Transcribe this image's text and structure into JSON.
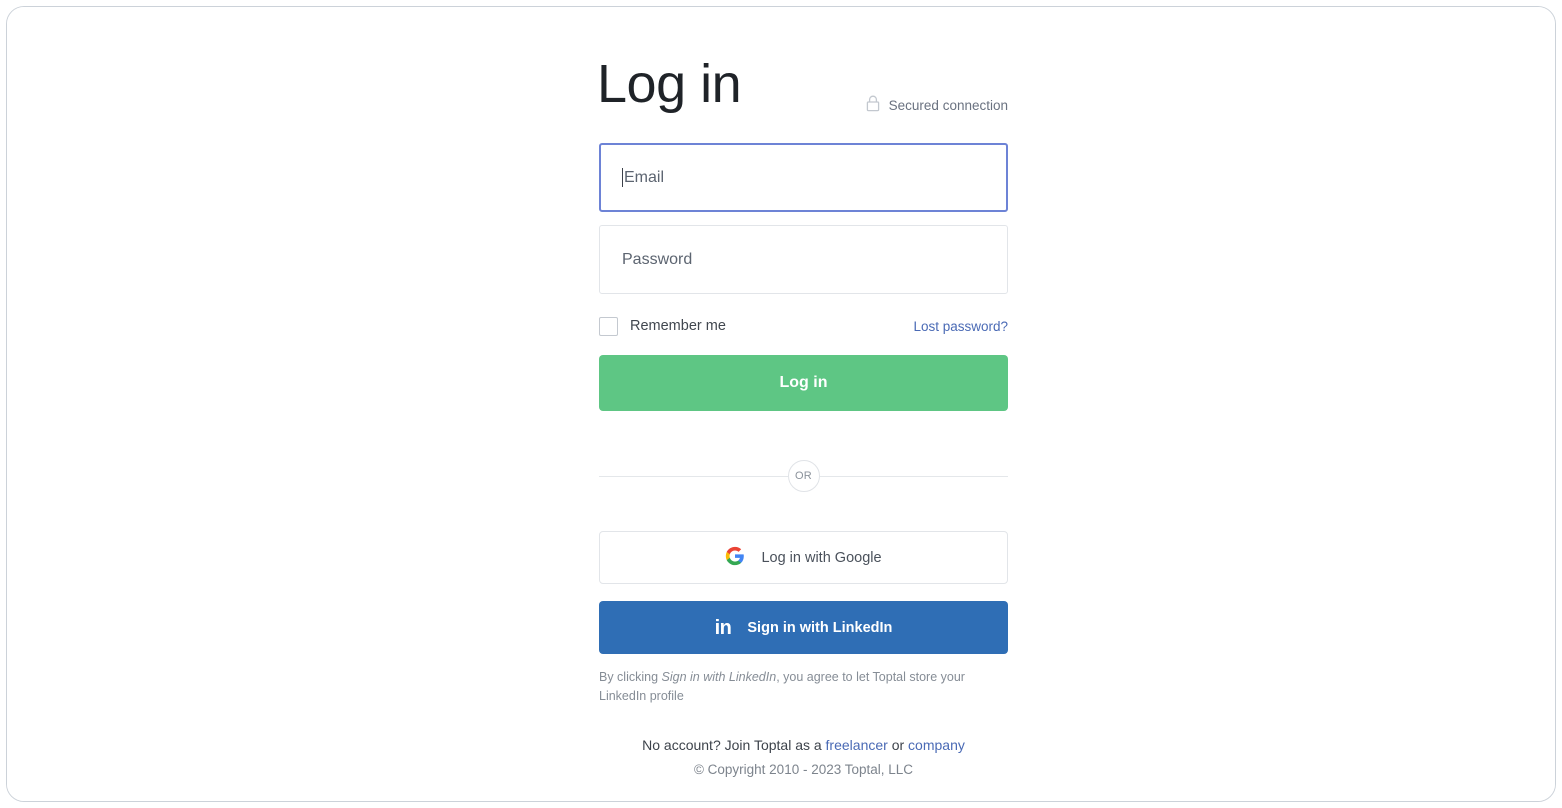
{
  "header": {
    "title": "Log in",
    "secured_text": "Secured connection",
    "lock_icon": "lock-icon"
  },
  "form": {
    "email": {
      "placeholder": "Email",
      "value": "",
      "focused": true
    },
    "password": {
      "placeholder": "Password",
      "value": ""
    },
    "remember_label": "Remember me",
    "remember_checked": false,
    "lost_password_label": "Lost password?",
    "submit_label": "Log in"
  },
  "divider": {
    "label": "OR"
  },
  "social": {
    "google": {
      "label": "Log in with Google",
      "icon": "google-g-icon"
    },
    "linkedin": {
      "label": "Sign in with LinkedIn",
      "icon": "linkedin-in-icon"
    },
    "disclaimer_prefix": "By clicking ",
    "disclaimer_emphasis": "Sign in with LinkedIn",
    "disclaimer_suffix": ", you agree to let Toptal store your LinkedIn profile"
  },
  "footer": {
    "join_prefix": "No account? Join Toptal as a ",
    "freelancer_link": "freelancer",
    "join_separator": " or ",
    "company_link": "company",
    "copyright": "© Copyright 2010 - 2023 Toptal, LLC"
  },
  "colors": {
    "primary_green": "#5ec684",
    "linkedin_blue": "#2f6eb5",
    "link_blue": "#4a6ab5",
    "focus_border": "#6d83d6"
  }
}
